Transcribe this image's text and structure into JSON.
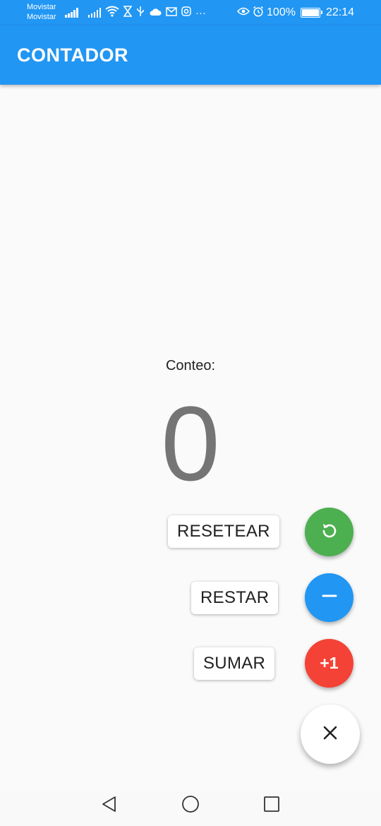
{
  "status_bar": {
    "carrier_1": "Movistar",
    "carrier_2": "Movistar",
    "more": "···",
    "battery_percent": "100%",
    "time": "22:14"
  },
  "app_bar": {
    "title": "CONTADOR"
  },
  "counter": {
    "label": "Conteo:",
    "value": "0"
  },
  "speed_dial": {
    "reset_label": "RESETEAR",
    "subtract_label": "RESTAR",
    "add_label": "SUMAR",
    "add_icon_text": "+1",
    "colors": {
      "reset": "#4caf50",
      "subtract": "#2196f3",
      "add": "#f44336",
      "main": "#ffffff"
    }
  },
  "icons": {
    "reset": "refresh-icon",
    "subtract": "minus-icon",
    "main": "close-icon",
    "nav_back": "back-triangle-icon",
    "nav_home": "home-circle-icon",
    "nav_recents": "recents-square-icon"
  },
  "theme": {
    "primary": "#2196f3",
    "background": "#fafafa"
  }
}
